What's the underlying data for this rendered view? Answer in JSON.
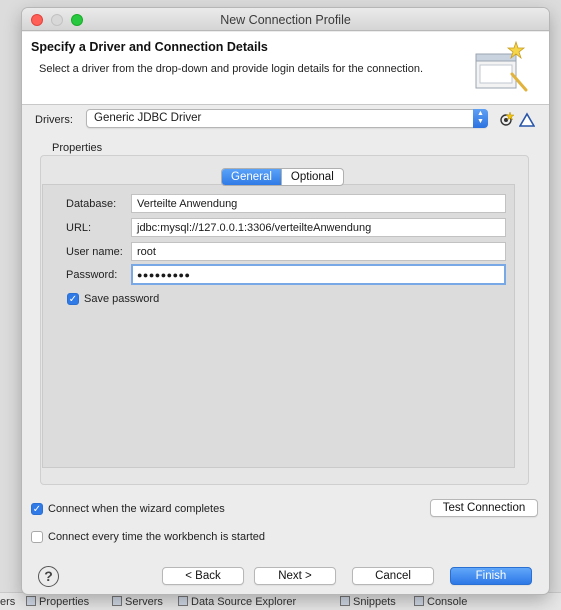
{
  "window": {
    "title": "New Connection Profile"
  },
  "banner": {
    "title": "Specify a Driver and Connection Details",
    "subtitle": "Select a driver from the drop-down and provide login details for the connection."
  },
  "drivers": {
    "label": "Drivers:",
    "selected": "Generic JDBC Driver"
  },
  "properties": {
    "group_label": "Properties",
    "tabs": [
      {
        "label": "General",
        "active": true
      },
      {
        "label": "Optional",
        "active": false
      }
    ],
    "fields": {
      "database": {
        "label": "Database:",
        "value": "Verteilte Anwendung"
      },
      "url": {
        "label": "URL:",
        "value": "jdbc:mysql://127.0.0.1:3306/verteilteAnwendung"
      },
      "username": {
        "label": "User name:",
        "value": "root"
      },
      "password": {
        "label": "Password:",
        "value": "●●●●●●●●●"
      }
    },
    "save_password": {
      "label": "Save password",
      "checked": true
    }
  },
  "options": {
    "connect_when_complete": {
      "label": "Connect when the wizard completes",
      "checked": true
    },
    "connect_every_time": {
      "label": "Connect every time the workbench is started",
      "checked": false
    }
  },
  "buttons": {
    "test_connection": "Test Connection",
    "back": "< Back",
    "next": "Next >",
    "cancel": "Cancel",
    "finish": "Finish",
    "help": "?"
  },
  "background_tabs": [
    "ers",
    "Properties",
    "Servers",
    "Data Source Explorer",
    "Snippets",
    "Console"
  ],
  "colors": {
    "accent": "#2f7ae6"
  }
}
